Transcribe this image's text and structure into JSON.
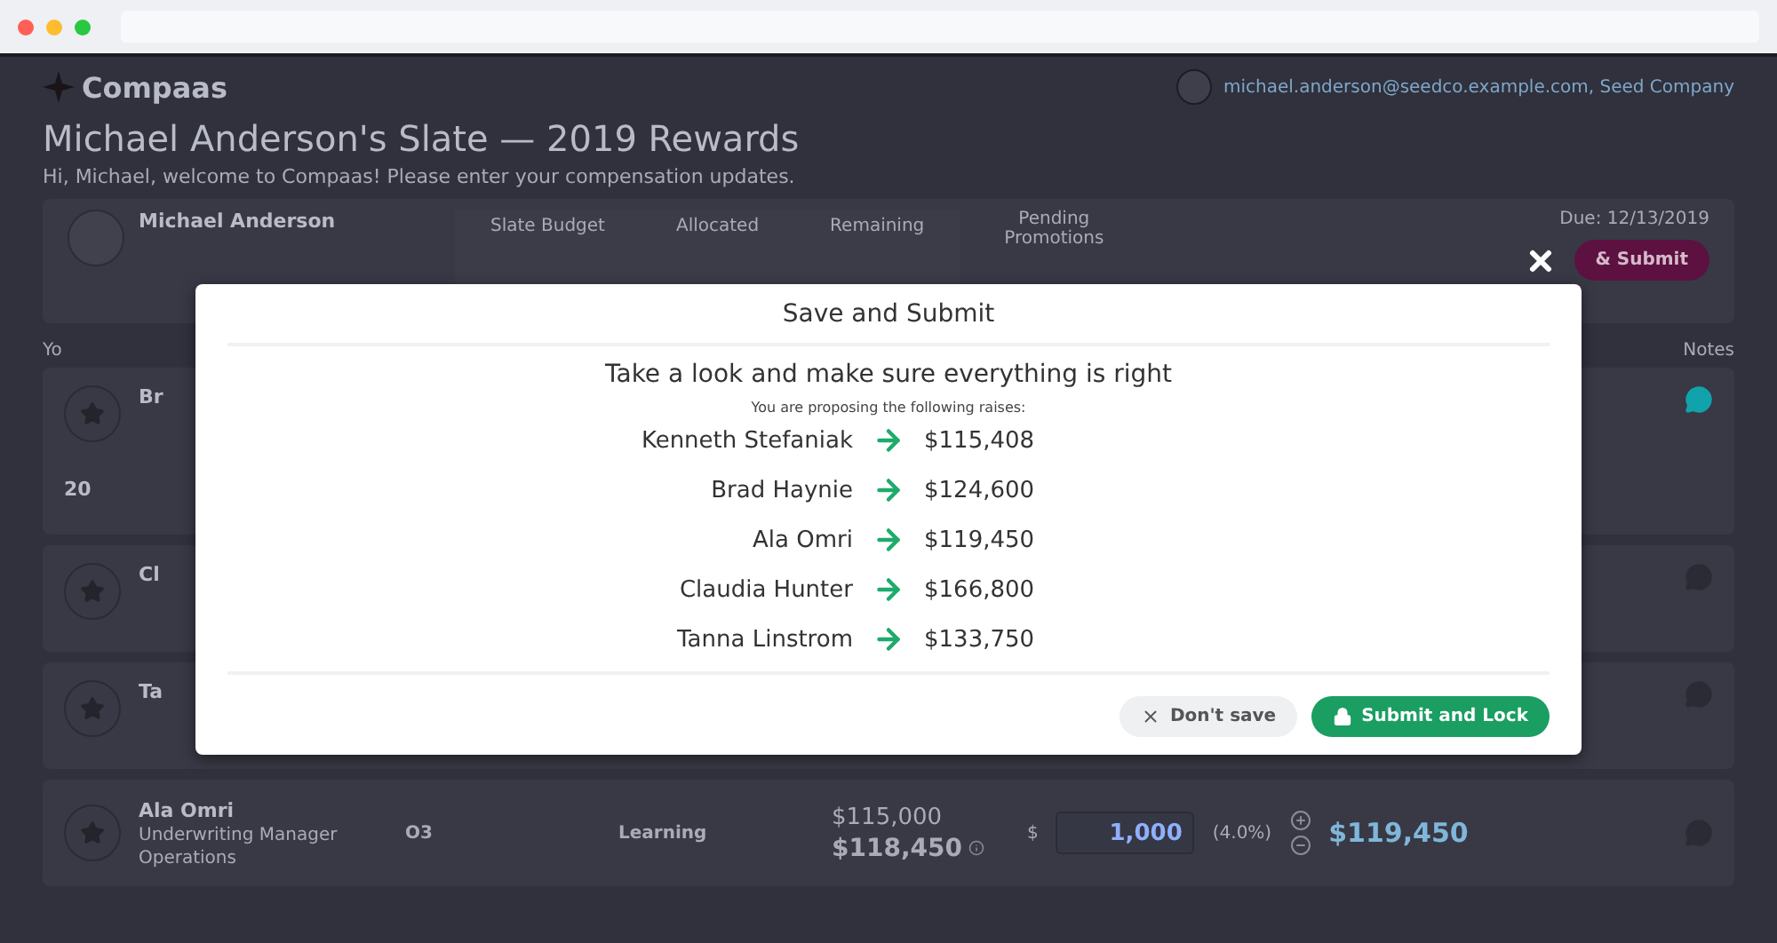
{
  "header": {
    "logo": "Compaas",
    "account": "michael.anderson@seedco.example.com, Seed Company"
  },
  "page": {
    "title": "Michael Anderson's Slate — 2019 Rewards",
    "subtitle": "Hi, Michael, welcome to Compaas! Please enter your compensation updates."
  },
  "summary": {
    "name": "Michael Anderson",
    "stats": [
      "Slate Budget",
      "Allocated",
      "Remaining"
    ],
    "pending": "Pending Promotions",
    "due": "Due: 12/13/2019",
    "submit": "& Submit"
  },
  "table": {
    "column_1": "Yo",
    "notes": "Notes",
    "rows": [
      {
        "kind": "partial",
        "name": "Br",
        "extra": "20",
        "has_note": true
      },
      {
        "kind": "partial",
        "name": "Cl",
        "has_note": false
      },
      {
        "kind": "partial",
        "name": "Ta",
        "has_note": false
      },
      {
        "kind": "full",
        "name": "Ala Omri",
        "role": "Underwriting Manager",
        "department": "Operations",
        "grade": "O3",
        "track": "Learning",
        "old_salary": "$115,000",
        "base_salary": "$118,450",
        "currency": "$",
        "raise": "1,000",
        "percent": "(4.0%)",
        "new_salary": "$119,450",
        "has_note": false
      }
    ]
  },
  "modal": {
    "title": "Save and Submit",
    "heading": "Take a look and make sure everything is right",
    "note": "You are proposing the following raises:",
    "raises": [
      {
        "name": "Kenneth Stefaniak",
        "amount": "$115,408"
      },
      {
        "name": "Brad Haynie",
        "amount": "$124,600"
      },
      {
        "name": "Ala Omri",
        "amount": "$119,450"
      },
      {
        "name": "Claudia Hunter",
        "amount": "$166,800"
      },
      {
        "name": "Tanna Linstrom",
        "amount": "$133,750"
      }
    ],
    "buttons": [
      {
        "kind": "secondary",
        "label": "Don't save"
      },
      {
        "kind": "primary",
        "label": "Submit and Lock"
      }
    ]
  }
}
